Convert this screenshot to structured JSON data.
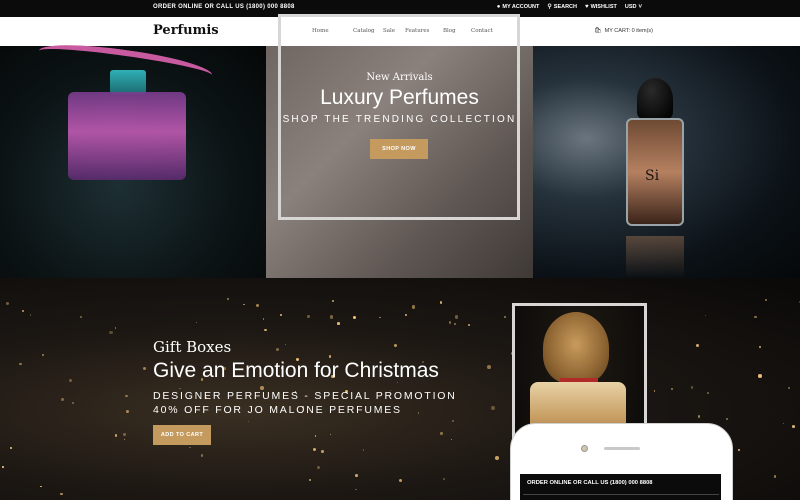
{
  "topbar": {
    "order_text": "ORDER ONLINE OR CALL US (1800) 000 8808",
    "my_account": "MY ACCOUNT",
    "search": "SEARCH",
    "wishlist": "WISHLIST",
    "currency": "USD"
  },
  "header": {
    "logo": "Perfumis",
    "nav": [
      "Home",
      "Catalog",
      "Sale",
      "Features",
      "Blog",
      "Contact"
    ],
    "cart": "MY CART: 0 item(s)"
  },
  "hero": {
    "subtitle": "New Arrivals",
    "title": "Luxury Perfumes",
    "tagline": "SHOP THE TRENDING COLLECTION",
    "button": "SHOP NOW",
    "bottle_label": "Si"
  },
  "promo": {
    "subtitle": "Gift Boxes",
    "title": "Give an Emotion for Christmas",
    "tagline": "DESIGNER PERFUMES - SPECIAL PROMOTION 40% OFF FOR JO MALONE PERFUMES",
    "button": "ADD TO CART"
  },
  "phone": {
    "order_text": "ORDER ONLINE OR CALL US (1800) 000 8808"
  },
  "colors": {
    "accent": "#c59a5e",
    "topbar": "#0b0b0b",
    "header": "#ffffff"
  },
  "icons": {
    "account": "user-icon",
    "search": "search-icon",
    "wishlist": "heart-icon",
    "currency": "chevron-down-icon",
    "cart": "bag-icon"
  }
}
